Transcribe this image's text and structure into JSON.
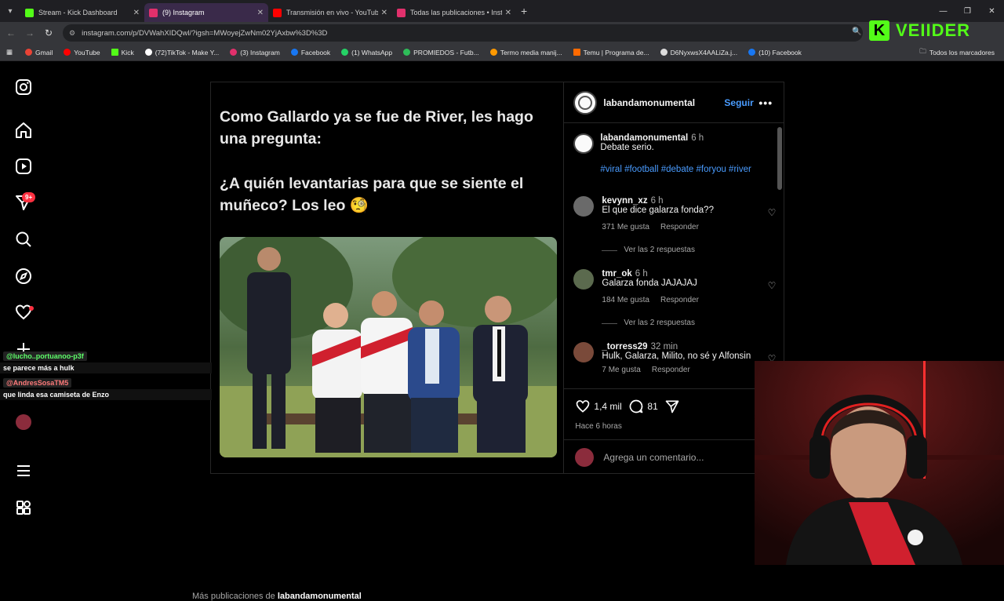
{
  "browser": {
    "tabs": [
      {
        "label": "Stream - Kick Dashboard",
        "color": "#53fc18",
        "active": false
      },
      {
        "label": "(9) Instagram",
        "color": "#e1306c",
        "active": true
      },
      {
        "label": "Transmisión en vivo - YouTube",
        "color": "#ff0000",
        "active": false
      },
      {
        "label": "Todas las publicaciones • Instag",
        "color": "#e1306c",
        "active": false
      }
    ],
    "url": "instagram.com/p/DVWahXIDQwl/?igsh=MWoyejZwNm02YjAxbw%3D%3D",
    "bookmarks": [
      {
        "label": "Gmail",
        "color": "#ea4335"
      },
      {
        "label": "YouTube",
        "color": "#ff0000"
      },
      {
        "label": "Kick",
        "color": "#53fc18"
      },
      {
        "label": "(72)TikTok - Make Y...",
        "color": "#ffffff"
      },
      {
        "label": "(3) Instagram",
        "color": "#e1306c"
      },
      {
        "label": "Facebook",
        "color": "#1877f2"
      },
      {
        "label": "(1) WhatsApp",
        "color": "#25d366"
      },
      {
        "label": "PROMIEDOS - Futb...",
        "color": "#2ebd59"
      },
      {
        "label": "Termo media manij...",
        "color": "#ff9900"
      },
      {
        "label": "Temu | Programa de...",
        "color": "#ff6a00"
      },
      {
        "label": "D6NyxwsX4AALiZa.j...",
        "color": "#dddddd"
      },
      {
        "label": "(10) Facebook",
        "color": "#1877f2"
      }
    ],
    "bookmarks_all": "Todos los marcadores"
  },
  "overlay": {
    "kick_logo": "K",
    "streamer_name": "VEIIDER",
    "chat": [
      {
        "user": "@lucho..portuanoo-p3f",
        "message": "se parece más a hulk"
      },
      {
        "user": "@AndresSosaTM5",
        "message": "que linda esa camiseta de Enzo"
      }
    ]
  },
  "post": {
    "meme_line1": "Como Gallardo ya se fue de River, les hago una pregunta:",
    "meme_line2": "¿A quién levantarias para que se siente el muñeco? Los leo 🧐",
    "author": "labandamonumental",
    "follow": "Seguir",
    "caption": {
      "user": "labandamonumental",
      "time": "6 h",
      "text": "Debate serio.",
      "tags": "#viral #football #debate #foryou #river"
    },
    "comments": [
      {
        "user": "kevynn_xz",
        "time": "6 h",
        "text": "El que dice galarza fonda??",
        "likes": "371 Me gusta",
        "reply": "Responder",
        "replies": "Ver las 2 respuestas"
      },
      {
        "user": "tmr_ok",
        "time": "6 h",
        "text": "Galarza fonda JAJAJAJ",
        "likes": "184 Me gusta",
        "reply": "Responder",
        "replies": "Ver las 2 respuestas"
      },
      {
        "user": "_torress29",
        "time": "32 min",
        "text": "Hulk, Galarza, Milito, no sé y Alfonsin",
        "likes": "7 Me gusta",
        "reply": "Responder"
      }
    ],
    "likes_count": "1,4 mil",
    "comments_count": "81",
    "posted": "Hace 6 horas",
    "add_comment": "Agrega un comentario...",
    "more_posts": "Más publicaciones de",
    "more_posts_user": "labandamonumental"
  },
  "sidebar": {
    "notifications_badge": "9+"
  }
}
